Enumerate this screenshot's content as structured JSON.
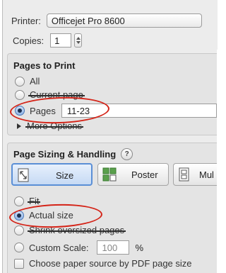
{
  "printer": {
    "label": "Printer:",
    "value": "Officejet Pro 8600"
  },
  "copies": {
    "label": "Copies:",
    "value": "1"
  },
  "pages_to_print": {
    "title": "Pages to Print",
    "options": {
      "all": "All",
      "current": "Current page",
      "pages": "Pages"
    },
    "pages_value": "11-23",
    "more_options": "More Options",
    "selected": "pages"
  },
  "page_sizing": {
    "title": "Page Sizing & Handling",
    "help": "?",
    "modes": {
      "size": "Size",
      "poster": "Poster",
      "multiple": "Mul"
    },
    "options": {
      "fit": "Fit",
      "actual": "Actual size",
      "shrink": "Shrink oversized pages",
      "custom": "Custom Scale:"
    },
    "custom_scale_value": "100",
    "percent": "%",
    "selected": "actual",
    "choose_paper": "Choose paper source by PDF page size"
  },
  "colors": {
    "highlight": "#d42418",
    "selected_blue": "#5b8fd6"
  }
}
